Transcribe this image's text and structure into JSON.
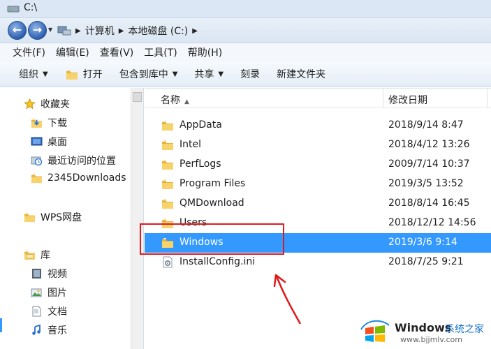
{
  "window": {
    "title": "C:\\"
  },
  "address": {
    "crumbs": [
      "计算机",
      "本地磁盘 (C:)"
    ]
  },
  "menu": [
    "文件(F)",
    "编辑(E)",
    "查看(V)",
    "工具(T)",
    "帮助(H)"
  ],
  "toolbar": {
    "organize": "组织",
    "open": "打开",
    "include_library": "包含到库中",
    "share": "共享",
    "burn": "刻录",
    "new_folder": "新建文件夹"
  },
  "nav": {
    "favorites": "收藏夹",
    "downloads": "下载",
    "desktop": "桌面",
    "recent": "最近访问的位置",
    "dl2345": "2345Downloads",
    "wps": "WPS网盘",
    "libraries": "库",
    "videos": "视频",
    "pictures": "图片",
    "documents": "文档",
    "music": "音乐"
  },
  "columns": {
    "name": "名称",
    "modified": "修改日期"
  },
  "files": [
    {
      "name": "AppData",
      "date": "2018/9/14 8:47",
      "type": "folder"
    },
    {
      "name": "Intel",
      "date": "2018/4/12 13:26",
      "type": "folder"
    },
    {
      "name": "PerfLogs",
      "date": "2009/7/14 10:37",
      "type": "folder"
    },
    {
      "name": "Program Files",
      "date": "2019/3/5 13:52",
      "type": "folder"
    },
    {
      "name": "QMDownload",
      "date": "2018/8/14 16:45",
      "type": "folder"
    },
    {
      "name": "Users",
      "date": "2018/12/12 14:56",
      "type": "folder"
    },
    {
      "name": "Windows",
      "date": "2019/3/6 9:14",
      "type": "folder",
      "selected": true
    },
    {
      "name": "InstallConfig.ini",
      "date": "2018/7/25 9:21",
      "type": "ini-file"
    }
  ],
  "colors": {
    "selection": "#3399ff",
    "annotation": "#e0191c",
    "folder": "#f2c14e"
  },
  "watermark": {
    "brand": "Windows",
    "site": "系统之家",
    "url": "www.bjjmlv.com"
  }
}
